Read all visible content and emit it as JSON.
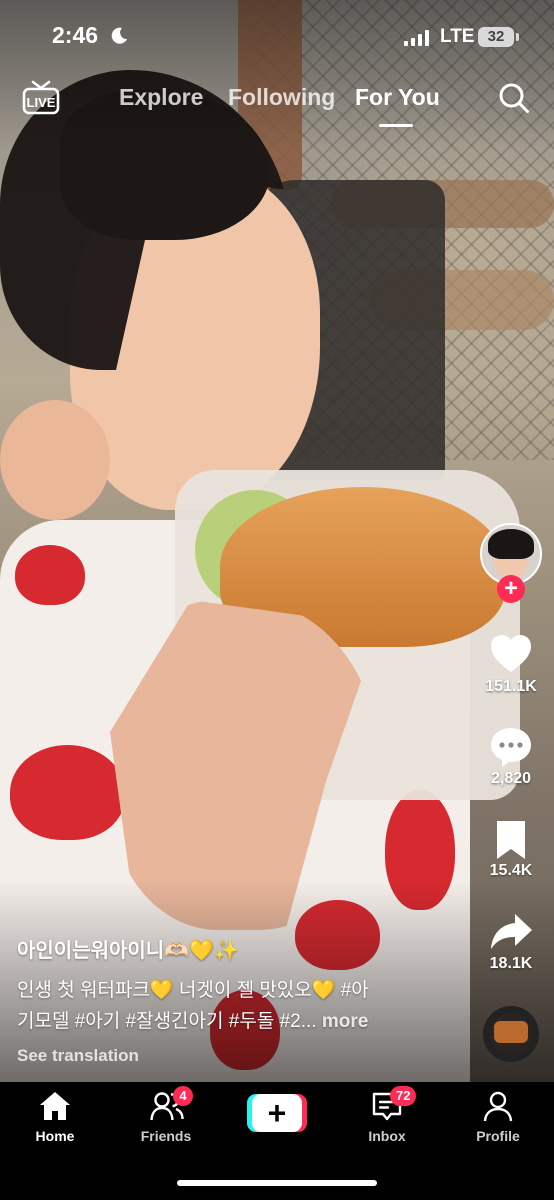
{
  "status_bar": {
    "time": "2:46",
    "network": "LTE",
    "battery": "32"
  },
  "top_nav": {
    "live_label": "LIVE",
    "tabs": [
      {
        "label": "Explore",
        "active": false
      },
      {
        "label": "Following",
        "active": false
      },
      {
        "label": "For You",
        "active": true
      }
    ]
  },
  "right_rail": {
    "likes": "151.1K",
    "comments": "2,820",
    "saves": "15.4K",
    "shares": "18.1K"
  },
  "caption": {
    "username": "아인이는워아이니🫶🏻💛✨",
    "line1": "인생 첫 워터파크💛 너겟이 젤 맛있오💛 #아",
    "line2": "기모델 #아기 #잘생긴아기 #두돌 #2...",
    "more": "more",
    "see_translation": "See translation"
  },
  "tab_bar": {
    "items": [
      {
        "label": "Home",
        "active": true
      },
      {
        "label": "Friends",
        "badge": "4"
      },
      {
        "label": "Inbox",
        "badge": "72"
      },
      {
        "label": "Profile"
      }
    ],
    "create_label": "+"
  },
  "colors": {
    "accent_red": "#fe2c55",
    "accent_cyan": "#25f4ee",
    "tab_bar_bg": "#000000"
  }
}
